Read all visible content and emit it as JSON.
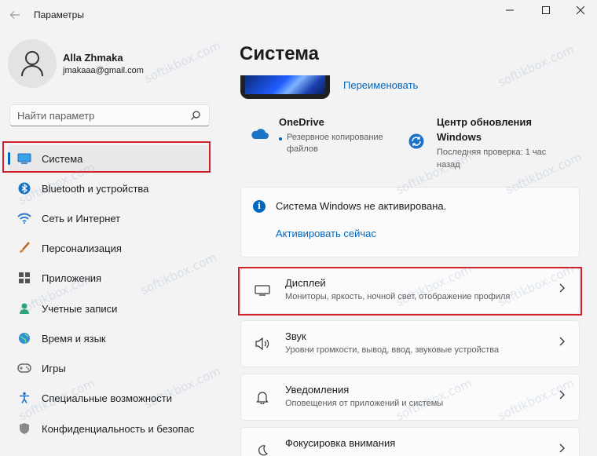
{
  "window": {
    "title": "Параметры"
  },
  "profile": {
    "name": "Alla Zhmaka",
    "email": "jmakaaa@gmail.com"
  },
  "search": {
    "placeholder": "Найти параметр"
  },
  "sidebar": {
    "items": [
      {
        "label": "Система",
        "icon": "monitor-icon"
      },
      {
        "label": "Bluetooth и устройства",
        "icon": "bluetooth-icon"
      },
      {
        "label": "Сеть и Интернет",
        "icon": "wifi-icon"
      },
      {
        "label": "Персонализация",
        "icon": "brush-icon"
      },
      {
        "label": "Приложения",
        "icon": "apps-icon"
      },
      {
        "label": "Учетные записи",
        "icon": "person-icon"
      },
      {
        "label": "Время и язык",
        "icon": "globe-icon"
      },
      {
        "label": "Игры",
        "icon": "gamepad-icon"
      },
      {
        "label": "Специальные возможности",
        "icon": "accessibility-icon"
      },
      {
        "label": "Конфиденциальность и безопас",
        "icon": "shield-icon"
      }
    ]
  },
  "main": {
    "title": "Система",
    "rename_link": "Переименовать",
    "onedrive": {
      "title": "OneDrive",
      "subtitle_line1": "Резервное копирование",
      "subtitle_line2": "файлов"
    },
    "update": {
      "title_line1": "Центр обновления",
      "title_line2": "Windows",
      "subtitle_line1": "Последняя проверка: 1 час",
      "subtitle_line2": "назад"
    },
    "activation": {
      "text": "Система Windows не активирована.",
      "link": "Активировать сейчас"
    },
    "rows": [
      {
        "title": "Дисплей",
        "subtitle": "Мониторы, яркость, ночной свет, отображение профиля",
        "icon": "display-icon"
      },
      {
        "title": "Звук",
        "subtitle": "Уровни громкости, вывод, ввод, звуковые устройства",
        "icon": "speaker-icon"
      },
      {
        "title": "Уведомления",
        "subtitle": "Оповещения от приложений и системы",
        "icon": "bell-icon"
      },
      {
        "title": "Фокусировка внимания",
        "subtitle": "",
        "icon": "moon-icon"
      }
    ]
  },
  "watermark": "softikbox.com",
  "colors": {
    "accent": "#0067c0",
    "highlight_box": "#d0202a",
    "background": "#f3f3f3"
  }
}
